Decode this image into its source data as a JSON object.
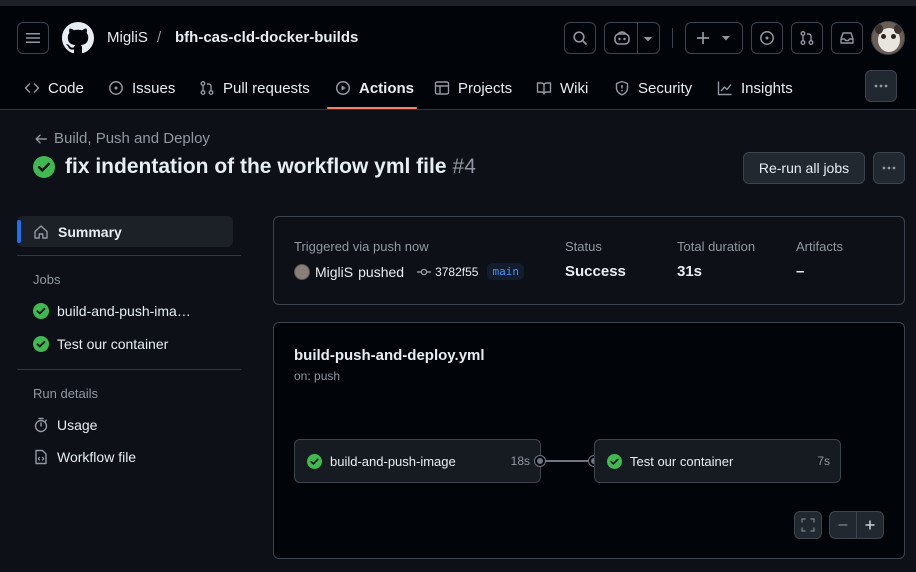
{
  "header": {
    "owner": "MigliS",
    "separator": "/",
    "repo": "bfh-cas-cld-docker-builds"
  },
  "tabs": [
    {
      "label": "Code",
      "icon": "code-icon"
    },
    {
      "label": "Issues",
      "icon": "issue-opened-icon"
    },
    {
      "label": "Pull requests",
      "icon": "git-pull-request-icon"
    },
    {
      "label": "Actions",
      "icon": "play-icon",
      "active": true
    },
    {
      "label": "Projects",
      "icon": "table-icon"
    },
    {
      "label": "Wiki",
      "icon": "book-icon"
    },
    {
      "label": "Security",
      "icon": "shield-icon"
    },
    {
      "label": "Insights",
      "icon": "graph-icon"
    }
  ],
  "run": {
    "workflow_back": "Build, Push and Deploy",
    "title": "fix indentation of the workflow yml file",
    "number": "#4",
    "rerun_label": "Re-run all jobs",
    "status_icon": "check-circle-fill-icon"
  },
  "sidebar": {
    "summary_label": "Summary",
    "jobs_heading": "Jobs",
    "jobs": [
      {
        "label": "build-and-push-ima…",
        "status": "success"
      },
      {
        "label": "Test our container",
        "status": "success"
      }
    ],
    "run_details_heading": "Run details",
    "details": [
      {
        "label": "Usage",
        "icon": "stopwatch-icon"
      },
      {
        "label": "Workflow file",
        "icon": "file-code-icon"
      }
    ]
  },
  "summary": {
    "triggered_label": "Triggered via push now",
    "actor": "MigliS",
    "action": "pushed",
    "commit_sha": "3782f55",
    "branch": "main",
    "status_label": "Status",
    "status_value": "Success",
    "duration_label": "Total duration",
    "duration_value": "31s",
    "artifacts_label": "Artifacts",
    "artifacts_value": "–"
  },
  "workflow": {
    "file": "build-push-and-deploy.yml",
    "trigger": "on: push",
    "jobs": [
      {
        "name": "build-and-push-image",
        "duration": "18s"
      },
      {
        "name": "Test our container",
        "duration": "7s"
      }
    ]
  },
  "colors": {
    "success": "#3fb950",
    "accent_underline": "#f78166",
    "link": "#4493f8",
    "selected_bar": "#1f6feb"
  }
}
